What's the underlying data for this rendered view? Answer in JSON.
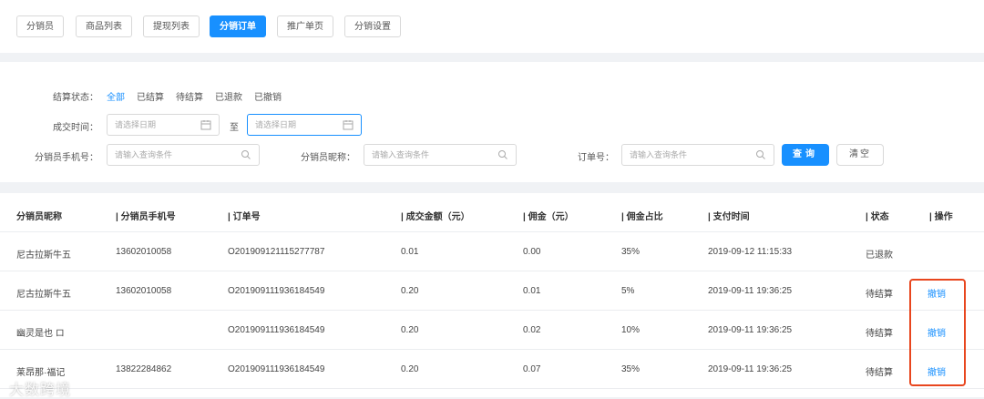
{
  "tabs": [
    "分销员",
    "商品列表",
    "提现列表",
    "分销订单",
    "推广单页",
    "分销设置"
  ],
  "active_tab": "分销订单",
  "filters": {
    "status_label": "结算状态：",
    "status_options": [
      "全部",
      "已结算",
      "待结算",
      "已退款",
      "已撤销"
    ],
    "time_label": "成交时间：",
    "date_placeholder": "请选择日期",
    "to_text": "至",
    "phone_label": "分销员手机号：",
    "nickname_label": "分销员昵称：",
    "order_label": "订单号：",
    "query_placeholder": "请输入查询条件",
    "query_button": "查询",
    "clear_button": "清空"
  },
  "table": {
    "headers": [
      "分销员昵称",
      "| 分销员手机号",
      "| 订单号",
      "| 成交金额（元）",
      "| 佣金（元）",
      "| 佣金占比",
      "| 支付时间",
      "| 状态",
      "| 操作"
    ],
    "rows": [
      [
        "尼古拉斯牛五",
        "13602010058",
        "O201909121115277787",
        "0.01",
        "0.00",
        "35%",
        "2019-09-12 11:15:33",
        "已退款",
        ""
      ],
      [
        "尼古拉斯牛五",
        "13602010058",
        "O201909111936184549",
        "0.20",
        "0.01",
        "5%",
        "2019-09-11 19:36:25",
        "待结算",
        "撤销"
      ],
      [
        "幽灵是也 ロ",
        "",
        "O201909111936184549",
        "0.20",
        "0.02",
        "10%",
        "2019-09-11 19:36:25",
        "待结算",
        "撤销"
      ],
      [
        "莱昂那·福记",
        "13822284862",
        "O201909111936184549",
        "0.20",
        "0.07",
        "35%",
        "2019-09-11 19:36:25",
        "待结算",
        "撤销"
      ]
    ]
  },
  "watermark": "大数跨境",
  "colors": {
    "accent": "#1890ff",
    "highlight_box": "#e8461e"
  }
}
